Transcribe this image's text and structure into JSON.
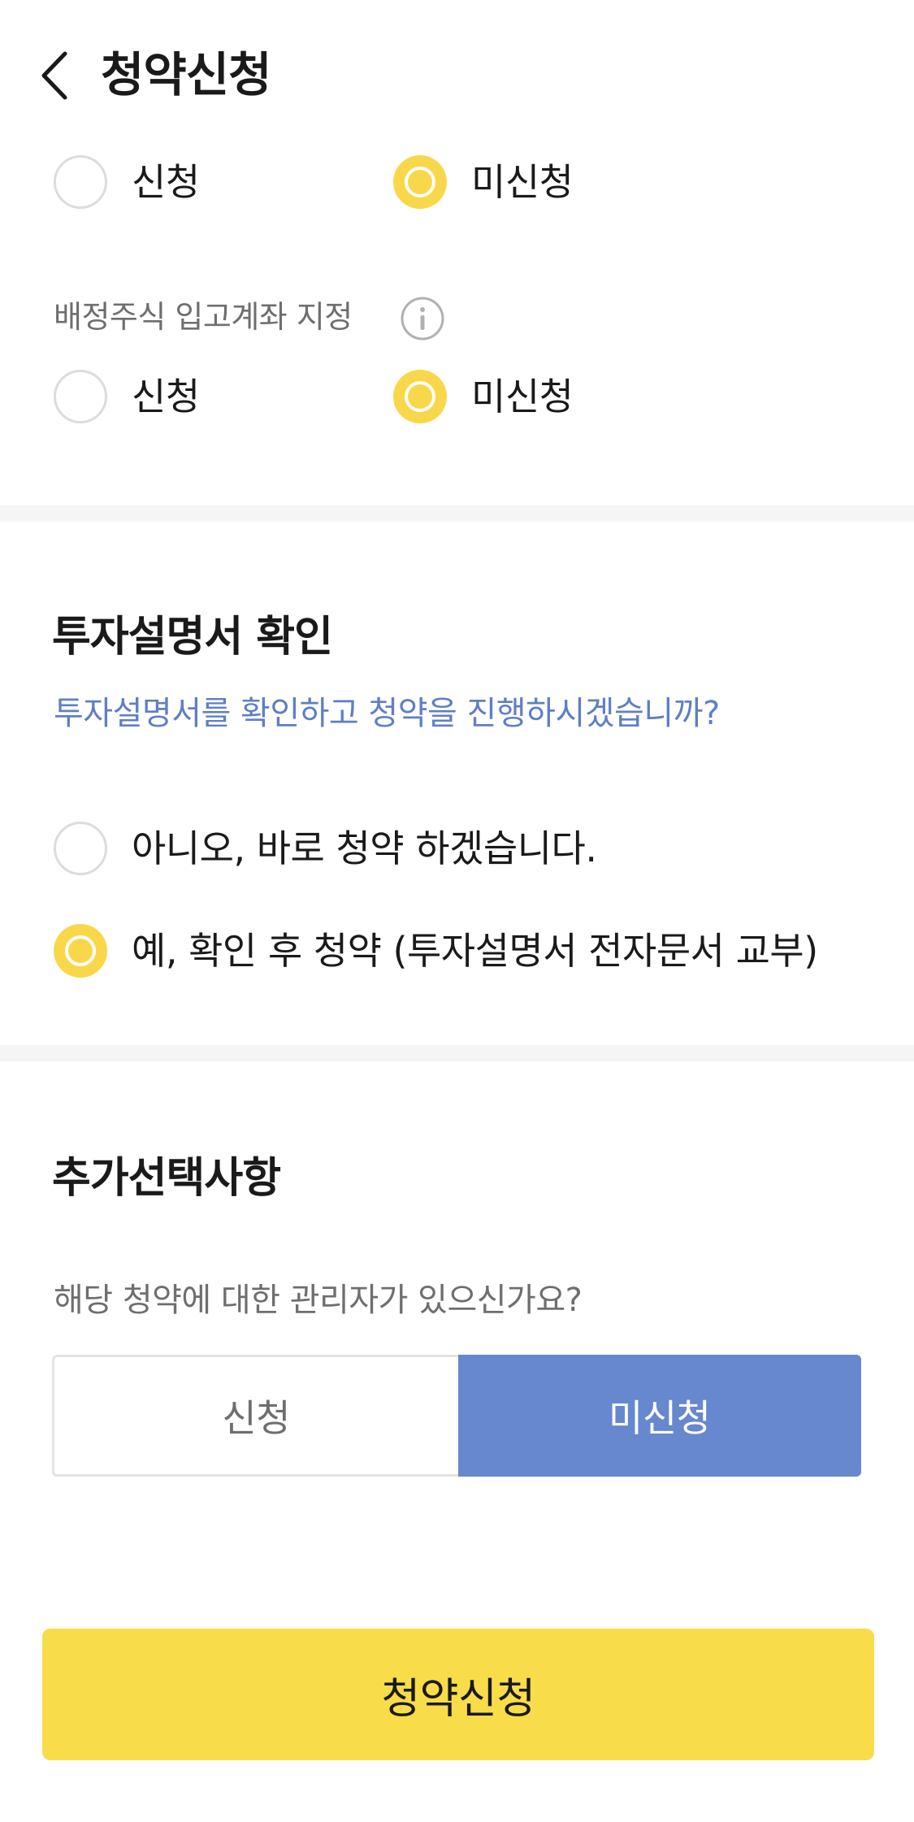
{
  "header": {
    "title": "청약신청",
    "back_icon": "chevron-left-icon"
  },
  "group1": {
    "options": [
      {
        "label": "신청",
        "selected": false
      },
      {
        "label": "미신청",
        "selected": true
      }
    ]
  },
  "group2": {
    "label": "배정주식 입고계좌 지정",
    "info_icon": "info-icon",
    "options": [
      {
        "label": "신청",
        "selected": false
      },
      {
        "label": "미신청",
        "selected": true
      }
    ]
  },
  "prospectus": {
    "title": "투자설명서 확인",
    "question": "투자설명서를 확인하고 청약을 진행하시겠습니까?",
    "options": [
      {
        "label": "아니오, 바로 청약 하겠습니다.",
        "selected": false
      },
      {
        "label": "예, 확인 후 청약 (투자설명서 전자문서 교부)",
        "selected": true
      }
    ]
  },
  "extra": {
    "title": "추가선택사항",
    "question": "해당 청약에 대한 관리자가 있으신가요?",
    "segment": {
      "left_label": "신청",
      "right_label": "미신청",
      "selected": "right"
    }
  },
  "submit": {
    "label": "청약신청"
  },
  "colors": {
    "accent_yellow": "#f8d84a",
    "accent_blue": "#6787cf",
    "question_blue": "#5f7fc4"
  }
}
